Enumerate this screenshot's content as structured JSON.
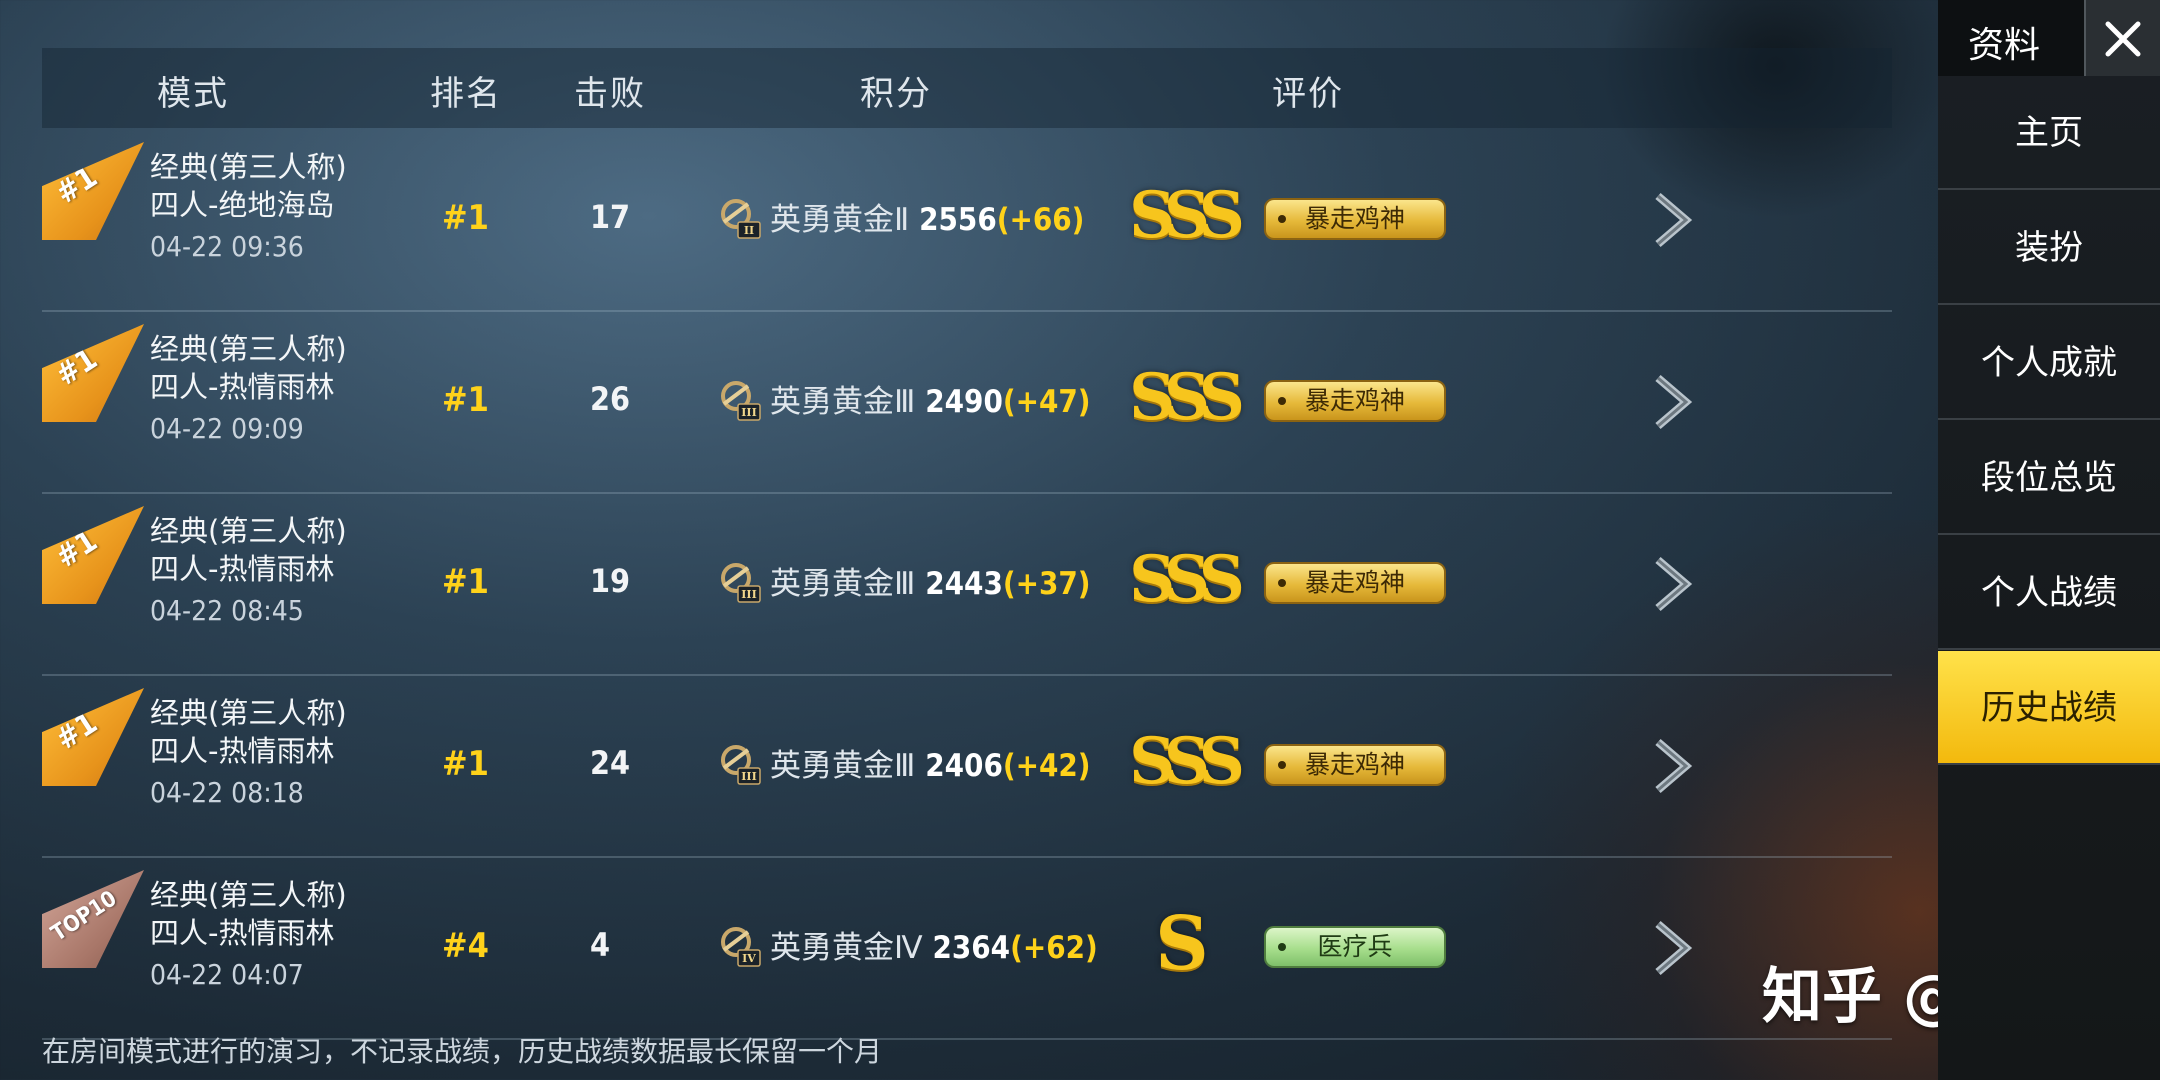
{
  "header": {
    "mode": "模式",
    "rank": "排名",
    "kills": "击败",
    "score": "积分",
    "rating": "评价"
  },
  "rows": [
    {
      "flag": "#1",
      "mode": "经典(第三人称)",
      "map": "四人-绝地海岛",
      "time": "04-22 09:36",
      "rank": "#1",
      "kills": "17",
      "tier_numeral": "II",
      "tier": "英勇黄金Ⅱ",
      "points": "2556",
      "delta": "(+66)",
      "grade": "SSS",
      "badge": "暴走鸡神",
      "badge_color": "gold"
    },
    {
      "flag": "#1",
      "mode": "经典(第三人称)",
      "map": "四人-热情雨林",
      "time": "04-22 09:09",
      "rank": "#1",
      "kills": "26",
      "tier_numeral": "III",
      "tier": "英勇黄金Ⅲ",
      "points": "2490",
      "delta": "(+47)",
      "grade": "SSS",
      "badge": "暴走鸡神",
      "badge_color": "gold"
    },
    {
      "flag": "#1",
      "mode": "经典(第三人称)",
      "map": "四人-热情雨林",
      "time": "04-22 08:45",
      "rank": "#1",
      "kills": "19",
      "tier_numeral": "III",
      "tier": "英勇黄金Ⅲ",
      "points": "2443",
      "delta": "(+37)",
      "grade": "SSS",
      "badge": "暴走鸡神",
      "badge_color": "gold"
    },
    {
      "flag": "#1",
      "mode": "经典(第三人称)",
      "map": "四人-热情雨林",
      "time": "04-22 08:18",
      "rank": "#1",
      "kills": "24",
      "tier_numeral": "III",
      "tier": "英勇黄金Ⅲ",
      "points": "2406",
      "delta": "(+42)",
      "grade": "SSS",
      "badge": "暴走鸡神",
      "badge_color": "gold"
    },
    {
      "flag": "TOP10",
      "mode": "经典(第三人称)",
      "map": "四人-热情雨林",
      "time": "04-22 04:07",
      "rank": "#4",
      "kills": "4",
      "tier_numeral": "IV",
      "tier": "英勇黄金Ⅳ",
      "points": "2364",
      "delta": "(+62)",
      "grade": "S",
      "badge": "医疗兵",
      "badge_color": "green"
    }
  ],
  "footer_note": "在房间模式进行的演习，不记录战绩，历史战绩数据最长保留一个月",
  "watermark": "知乎 @悲鸣",
  "sidebar": {
    "title": "资料",
    "close_icon": "close-icon",
    "items": [
      {
        "label": "主页",
        "active": false
      },
      {
        "label": "装扮",
        "active": false
      },
      {
        "label": "个人成就",
        "active": false
      },
      {
        "label": "段位总览",
        "active": false
      },
      {
        "label": "个人战绩",
        "active": false
      },
      {
        "label": "历史战绩",
        "active": true
      }
    ]
  },
  "colors": {
    "accent": "#ffd21a",
    "active_tab": "#f3b90d",
    "flag_gold": "#e7931b",
    "flag_top10": "#a87668"
  }
}
